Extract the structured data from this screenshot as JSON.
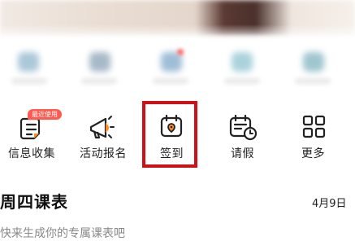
{
  "quick_actions": [
    {
      "id": "info-collect",
      "label": "信息收集",
      "icon": "document-chat-icon"
    },
    {
      "id": "activity-signup",
      "label": "活动报名",
      "icon": "megaphone-icon"
    },
    {
      "id": "check-in",
      "label": "签到",
      "icon": "calendar-location-icon",
      "highlighted": true
    },
    {
      "id": "leave",
      "label": "请假",
      "icon": "calendar-clock-icon"
    },
    {
      "id": "more",
      "label": "更多",
      "icon": "grid-icon"
    }
  ],
  "recent_badge": "最近使用",
  "schedule": {
    "title": "周四课表",
    "date": "4月9日",
    "hint": "快来生成你的专属课表吧"
  },
  "colors": {
    "highlight": "#d01017",
    "badge": "#ff5a4f",
    "icon_stroke": "#222222"
  }
}
